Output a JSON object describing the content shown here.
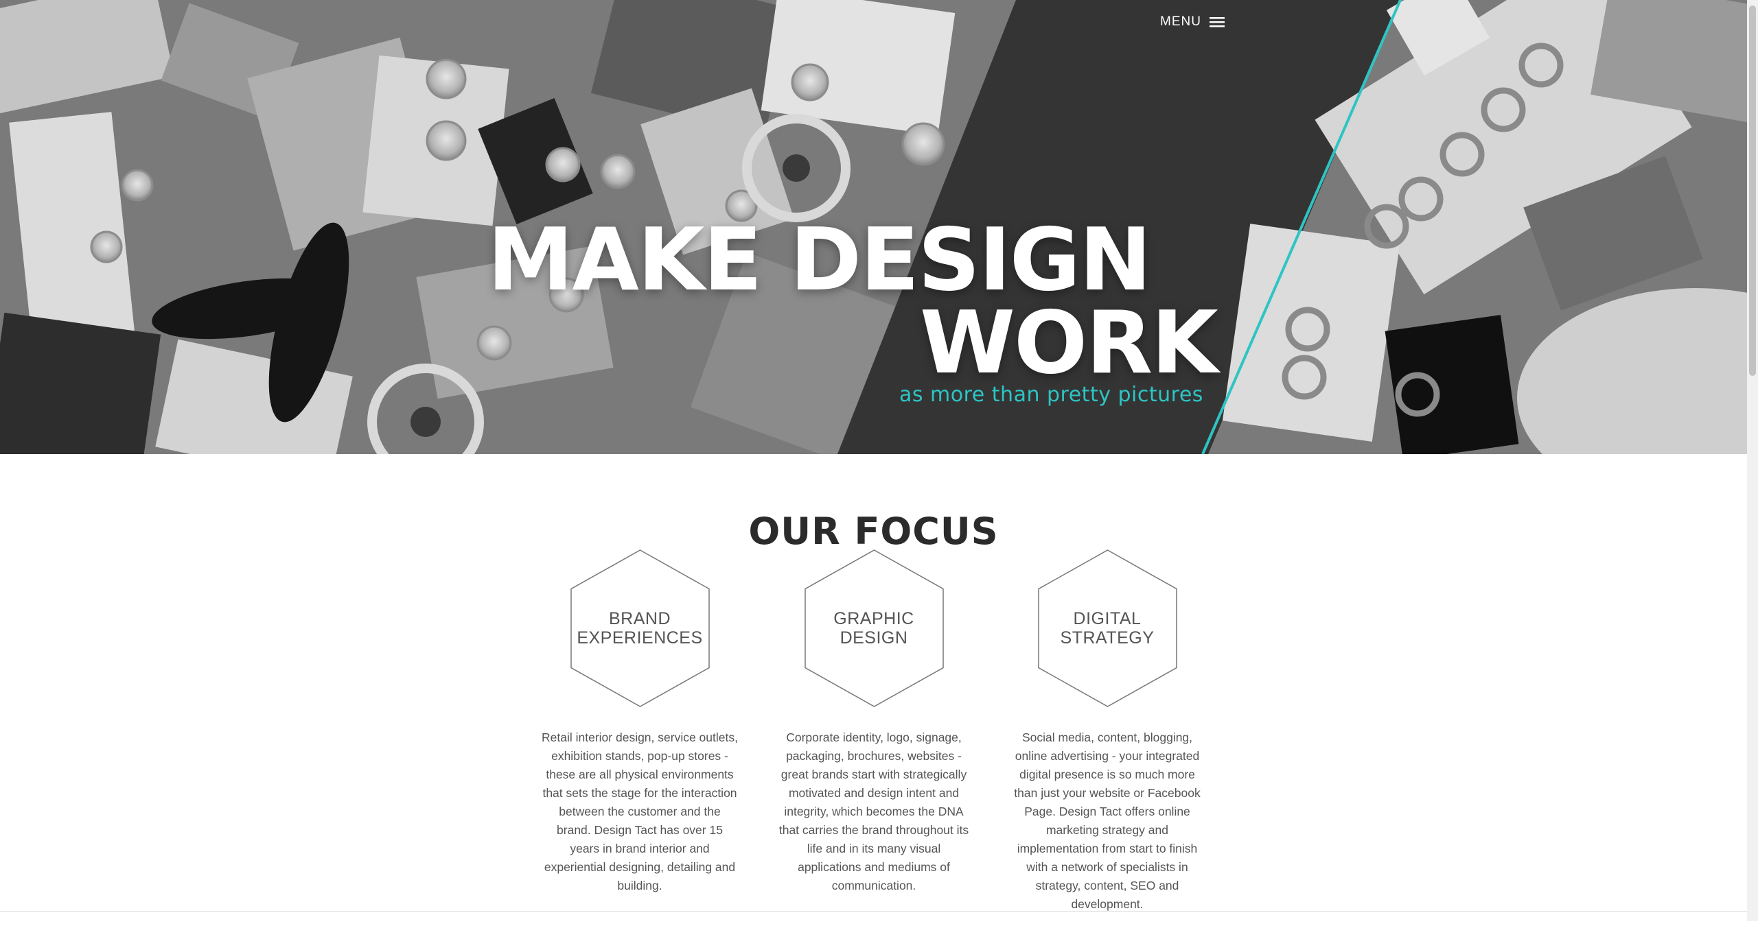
{
  "header": {
    "menu_label": "MENU",
    "menu_icon": "hamburger-icon"
  },
  "hero": {
    "title_line1": "MAKE DESIGN",
    "title_line2": "WORK",
    "subtitle": "as more than pretty pictures",
    "accent_color": "#2ec4c4"
  },
  "focus": {
    "title": "OUR FOCUS",
    "cards": [
      {
        "label_line1": "BRAND",
        "label_line2": "EXPERIENCES",
        "text": "Retail interior design, service outlets, exhibition stands, pop-up stores - these are all physical environments that sets the stage for the interaction between the customer and the brand. Design Tact has over 15 years in brand interior and experiential designing, detailing and building."
      },
      {
        "label_line1": "GRAPHIC",
        "label_line2": "DESIGN",
        "text": "Corporate identity, logo, signage, packaging, brochures, websites - great brands start with strategically motivated and design intent and integrity, which becomes the DNA that carries the brand throughout its life and in its many visual applications and mediums of communication."
      },
      {
        "label_line1": "DIGITAL",
        "label_line2": "STRATEGY",
        "text": "Social media, content, blogging, online advertising - your integrated digital presence is so much more than just your website or Facebook Page. Design Tact offers online marketing strategy and implementation from start to finish with a network of specialists in strategy, content, SEO and development."
      }
    ]
  }
}
